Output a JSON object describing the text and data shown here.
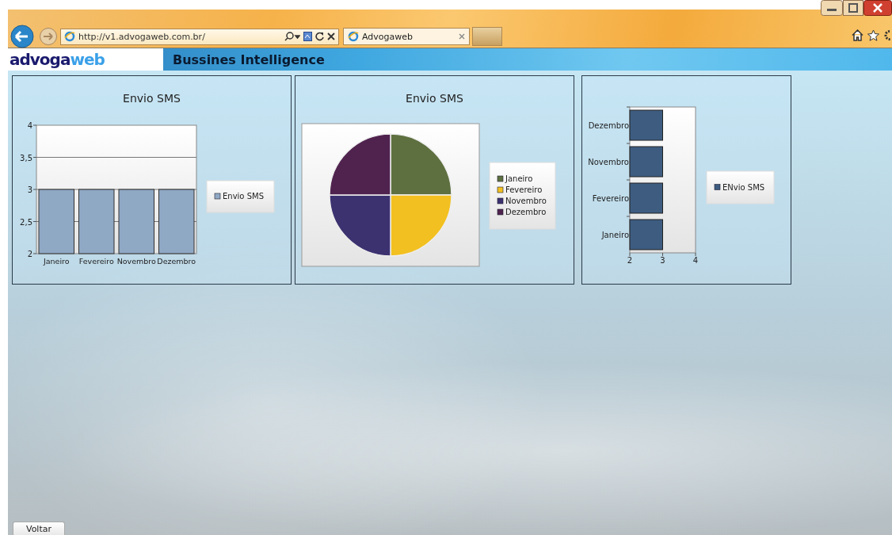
{
  "browser": {
    "address": "http://v1.advogaweb.com.br/",
    "tabs": [
      {
        "title": "Advogaweb",
        "selected": true
      }
    ]
  },
  "header": {
    "logo": {
      "part_1": "advoga",
      "part_2": "web"
    },
    "title": "Bussines Intelligence"
  },
  "panels": [
    {
      "chart_data": {
        "type": "bar",
        "orientation": "vertical",
        "title": "Envio SMS",
        "grid": true,
        "legend": true,
        "categories": [
          "Janeiro",
          "Fevereiro",
          "Novembro",
          "Dezembro"
        ],
        "series": [
          {
            "name": "Envio SMS",
            "color": "#8fa8c4",
            "values": [
              3,
              3,
              3,
              3
            ]
          }
        ],
        "ylim": [
          2,
          4
        ],
        "yticks": [
          {
            "value": 2,
            "label": "2"
          },
          {
            "value": 2.5,
            "label": "2,5"
          },
          {
            "value": 3,
            "label": "3"
          },
          {
            "value": 3.5,
            "label": "3,5"
          },
          {
            "value": 4,
            "label": "4"
          }
        ]
      }
    },
    {
      "chart_data": {
        "type": "pie",
        "title": "Envio SMS",
        "legend": true,
        "categories": [
          "Janeiro",
          "Fevereiro",
          "Novembro",
          "Dezembro"
        ],
        "values": [
          25,
          25,
          25,
          25
        ],
        "colors": [
          "#5e7040",
          "#f2c020",
          "#3d3270",
          "#50234f"
        ]
      }
    },
    {
      "chart_data": {
        "type": "bar",
        "orientation": "horizontal",
        "legend": true,
        "categories": [
          "Dezembro",
          "Novembro",
          "Fevereiro",
          "Janeiro"
        ],
        "series": [
          {
            "name": "ENvio SMS",
            "color": "#3d5c80",
            "values": [
              3,
              3,
              3,
              3
            ]
          }
        ],
        "xlim": [
          2,
          4
        ],
        "xticks": [
          2,
          3,
          4
        ]
      }
    }
  ],
  "footer": {
    "back_button": "Voltar"
  }
}
